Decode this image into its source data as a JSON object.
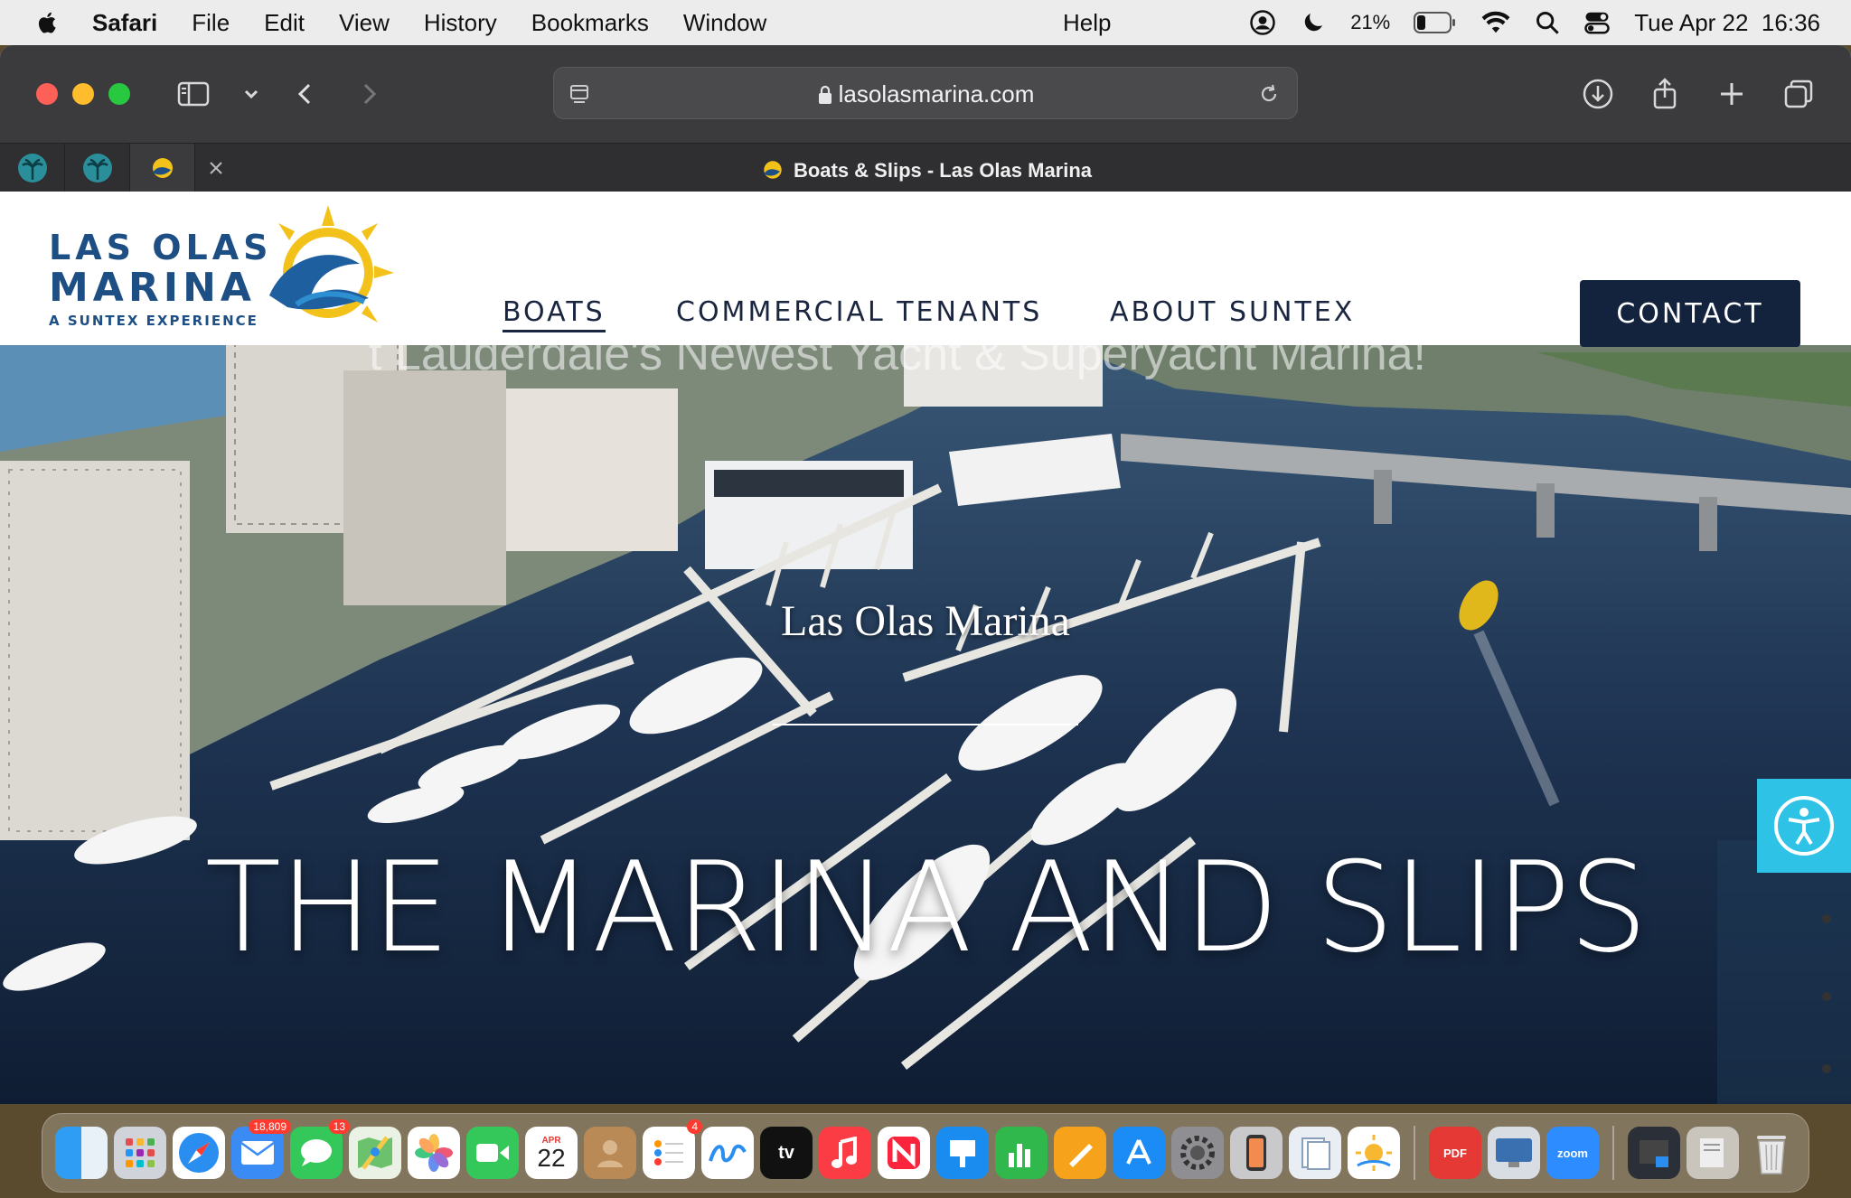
{
  "menubar": {
    "app": "Safari",
    "items": [
      "File",
      "Edit",
      "View",
      "History",
      "Bookmarks",
      "Window"
    ],
    "help": "Help",
    "battery": "21%",
    "datetime": "Tue Apr 22  16:36"
  },
  "browser": {
    "url": "lasolasmarina.com",
    "tab_title": "Boats & Slips - Las Olas Marina"
  },
  "site": {
    "logo": {
      "line1": "LAS OLAS",
      "line2": "MARINA",
      "line3": "A SUNTEX EXPERIENCE"
    },
    "nav": {
      "boats": "BOATS",
      "tenants": "COMMERCIAL TENANTS",
      "about": "ABOUT SUNTEX"
    },
    "contact": "CONTACT",
    "tagline": "t Lauderdale's Newest Yacht & Superyacht Marina!",
    "hero_subtitle": "Las Olas Marina",
    "hero_title": "THE MARINA AND SLIPS"
  },
  "dock": {
    "mail_badge": "18,809",
    "messages_badge": "13",
    "calendar_month": "APR",
    "calendar_day": "22",
    "reminders_badge": "4",
    "tv_label": "tv",
    "pdf_label": "PDF",
    "zoom_label": "zoom"
  },
  "colors": {
    "brand_navy": "#14233d",
    "accent_cyan": "#2ec2e6",
    "logo_blue": "#1e4f84",
    "logo_yellow": "#f2c21b"
  }
}
